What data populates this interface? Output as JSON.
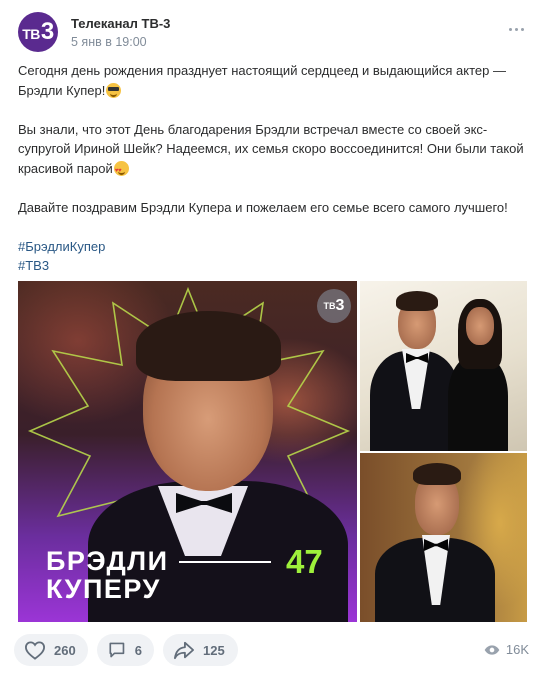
{
  "post": {
    "channel_name": "Телеканал ТВ-3",
    "avatar_text": "ТВ",
    "avatar_digit": "3",
    "date": "5 янв в 19:00",
    "paragraph1": "Сегодня день рождения празднует настоящий сердцеед и выдающийся актер — Брэдли Купер!",
    "paragraph2": "Вы знали, что этот День благодарения Брэдли встречал вместе со своей экс-супругой Ириной Шейк? Надеемся, их семья скоро воссоединится! Они были такой красивой парой",
    "paragraph3": "Давайте поздравим Брэдли Купера и пожелаем его семье всего самого лучшего!",
    "hashtags": [
      "#БрэдлиКупер",
      "#ТВ3"
    ]
  },
  "main_image": {
    "badge_text": "ТВ",
    "badge_digit": "3",
    "overlay_line1": "БРЭДЛИ",
    "overlay_line2": "КУПЕРУ",
    "overlay_age": "47"
  },
  "footer": {
    "likes": "260",
    "comments": "6",
    "shares": "125",
    "views": "16K"
  },
  "colors": {
    "accent_purple": "#5a2a8f",
    "link": "#2a5885",
    "age_green": "#9ef03b"
  },
  "icons": {
    "more": "more-horizontal-icon",
    "like": "heart-icon",
    "comment": "comment-icon",
    "share": "share-arrow-icon",
    "views": "eye-icon"
  }
}
